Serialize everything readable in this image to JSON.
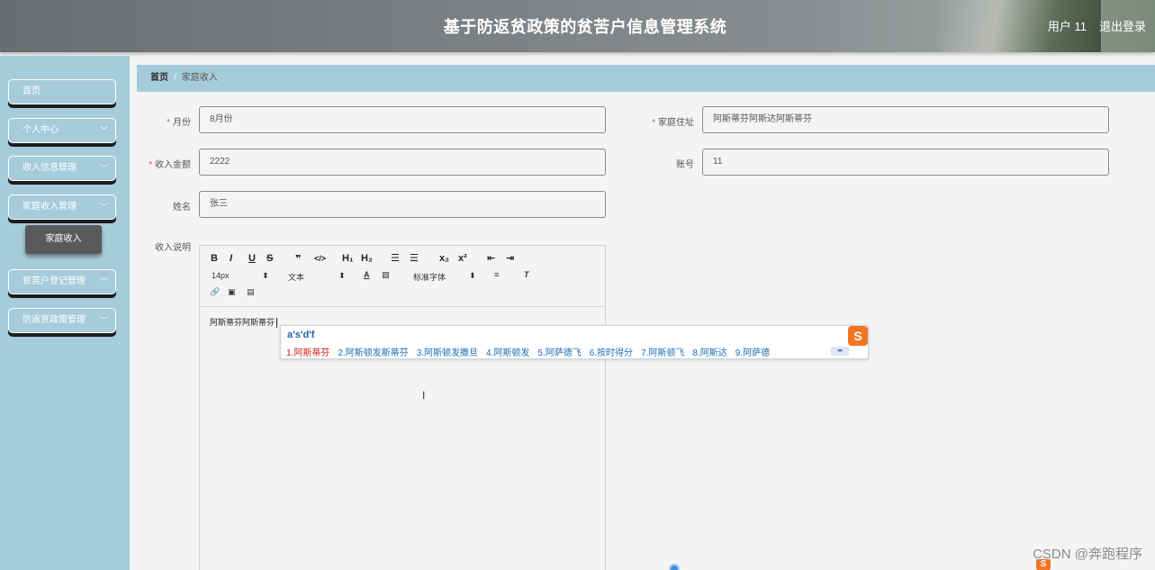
{
  "header": {
    "title": "基于防返贫政策的贫苦户信息管理系统",
    "user": "用户 11",
    "logout": "退出登录"
  },
  "sidebar": {
    "items": [
      {
        "label": "首页"
      },
      {
        "label": "个人中心"
      },
      {
        "label": "收入信息管理"
      },
      {
        "label": "家庭收入管理"
      },
      {
        "label": "贫苦户登记管理"
      },
      {
        "label": "防返贫政策管理"
      }
    ],
    "sub_item": "家庭收入"
  },
  "breadcrumb": {
    "home": "首页",
    "separator": "/",
    "current": "家庭收入"
  },
  "form": {
    "month": {
      "label": "月份",
      "value": "8月份"
    },
    "address": {
      "label": "家庭住址",
      "value": "阿斯蒂芬阿斯达阿斯蒂芬"
    },
    "amount": {
      "label": "收入金额",
      "value": "2222"
    },
    "account": {
      "label": "账号",
      "value": "11"
    },
    "name": {
      "label": "姓名",
      "value": "张三"
    },
    "description": {
      "label": "收入说明"
    }
  },
  "editor": {
    "toolbar": {
      "font_size": "14px",
      "text_type": "文本",
      "font_family": "标准字体"
    },
    "content": "阿斯蒂芬阿斯蒂芬"
  },
  "ime": {
    "input": "a's'd'f",
    "candidates": [
      "1.阿斯蒂芬",
      "2.阿斯顿发斯蒂芬",
      "3.阿斯顿发撒旦",
      "4.阿斯顿发",
      "5.阿萨德飞",
      "6.按时得分",
      "7.阿斯顿飞",
      "8.阿斯达",
      "9.阿萨德"
    ]
  },
  "watermark": "CSDN @奔跑程序",
  "colors": {
    "accent": "#a6ccdb",
    "required": "#e05050",
    "ime_brand": "#f27522"
  }
}
